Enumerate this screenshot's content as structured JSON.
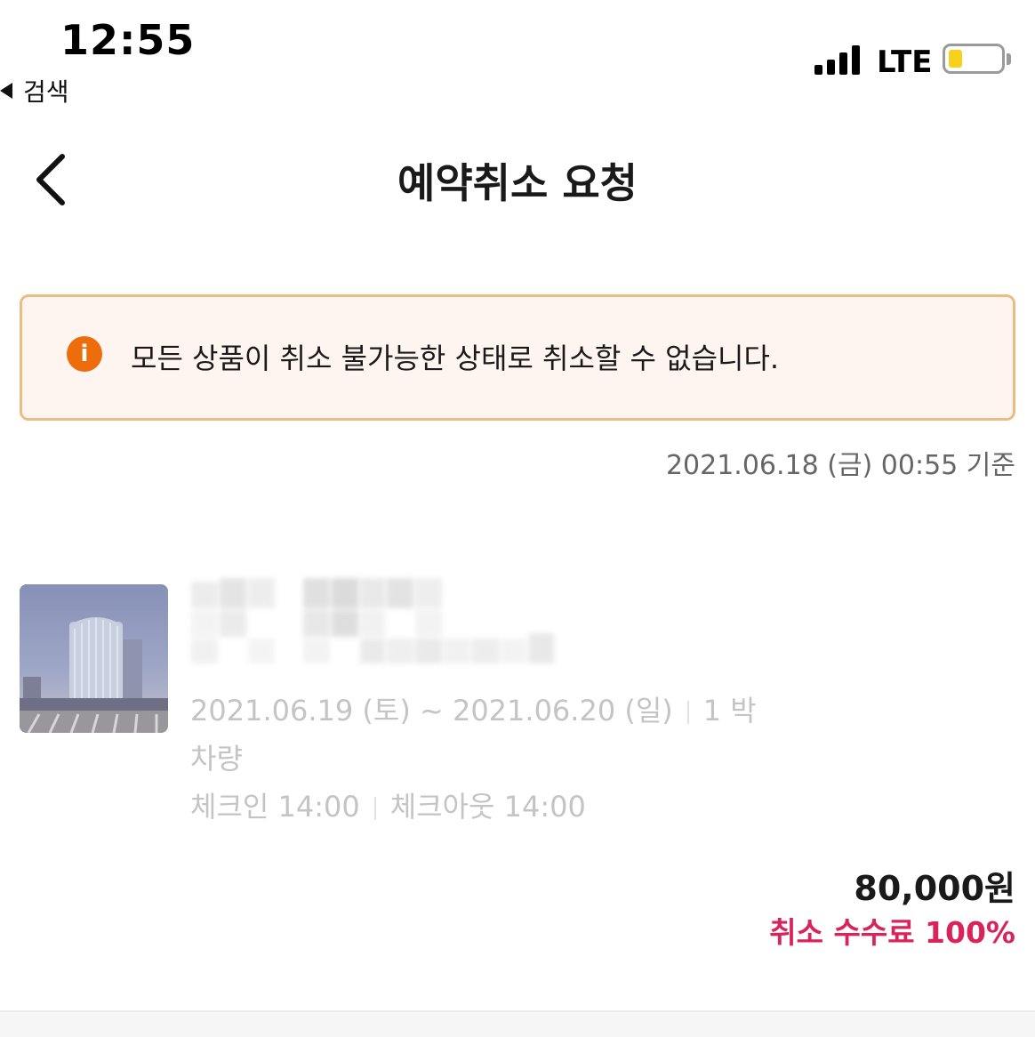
{
  "status_bar": {
    "time": "12:55",
    "back_app_label": "검색",
    "network": "LTE",
    "battery_level": 0.15,
    "battery_color": "#f7d11e"
  },
  "header": {
    "title": "예약취소 요청",
    "back_icon": "chevron-left-icon"
  },
  "notice": {
    "icon": "info-icon",
    "icon_glyph": "i",
    "message": "모든 상품이 취소 불가능한 상태로 취소할 수 없습니다.",
    "accent_color": "#ed6c0c",
    "border_color": "#ebbd84",
    "background_color": "#fff5f0"
  },
  "as_of": "2021.06.18 (금) 00:55 기준",
  "reservation": {
    "dates": "2021.06.19 (토) ~ 2021.06.20 (일)",
    "nights": "1 박",
    "room_type": "차량",
    "check_in": "체크인 14:00",
    "check_out": "체크아웃 14:00",
    "price": "80,000원",
    "cancel_fee": "취소 수수료 100%",
    "cancel_fee_color": "#d8245a"
  }
}
